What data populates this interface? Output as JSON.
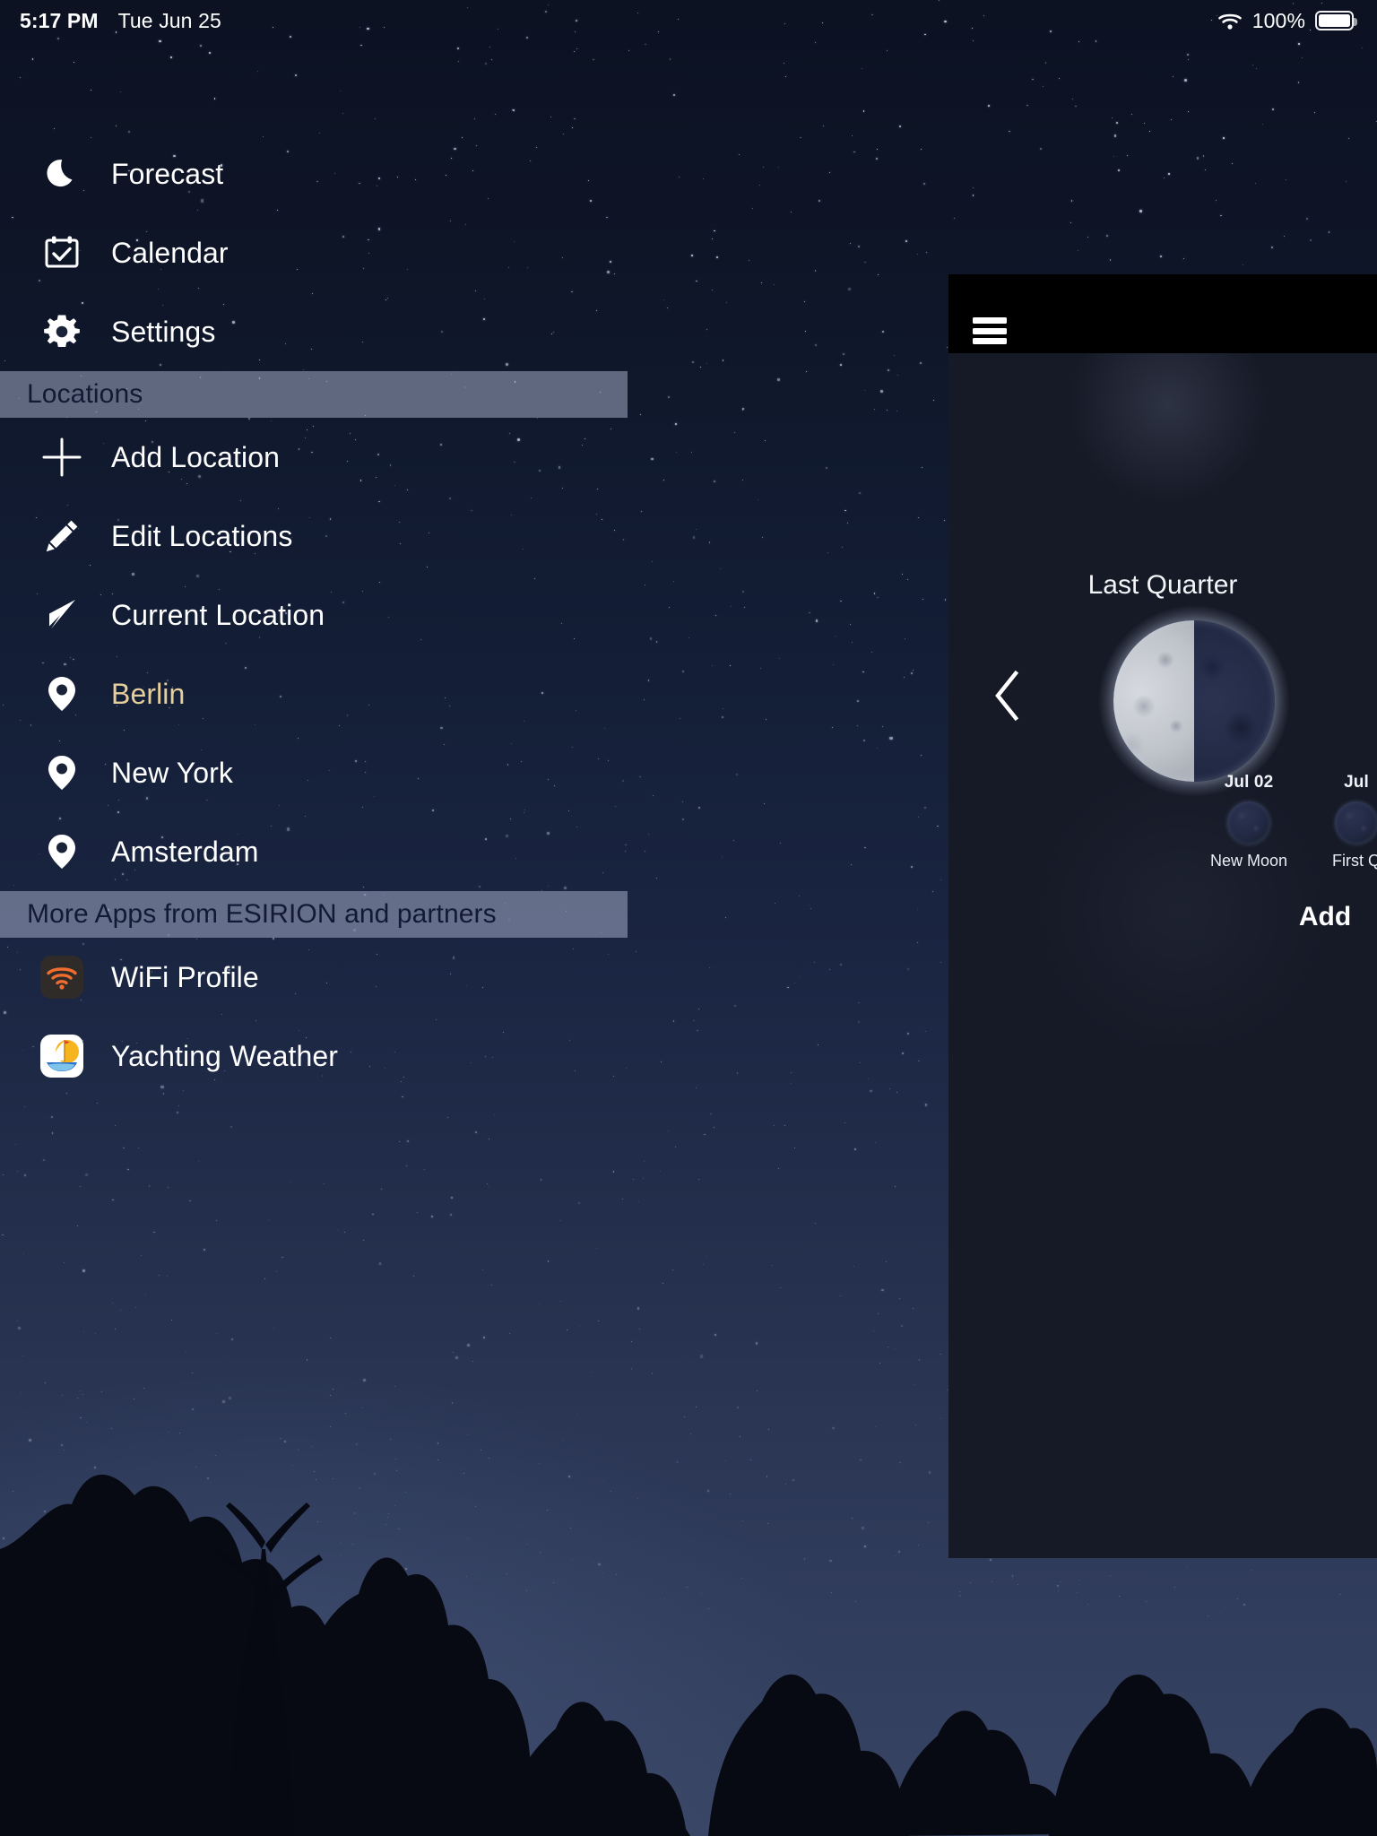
{
  "statusbar": {
    "time": "5:17 PM",
    "date": "Tue Jun 25",
    "wifi_icon": "wifi-icon",
    "battery_percent": "100%",
    "battery_icon": "battery-full-icon"
  },
  "sidebar": {
    "primary_items": [
      {
        "label": "Forecast",
        "icon": "crescent-moon-icon"
      },
      {
        "label": "Calendar",
        "icon": "calendar-check-icon"
      },
      {
        "label": "Settings",
        "icon": "gear-icon"
      }
    ],
    "locations_section": {
      "title": "Locations",
      "items": [
        {
          "label": "Add Location",
          "icon": "plus-icon",
          "accent": false
        },
        {
          "label": "Edit Locations",
          "icon": "pencil-icon",
          "accent": false
        },
        {
          "label": "Current Location",
          "icon": "navigate-icon",
          "accent": false
        },
        {
          "label": "Berlin",
          "icon": "map-pin-icon",
          "accent": true
        },
        {
          "label": "New York",
          "icon": "map-pin-icon",
          "accent": false
        },
        {
          "label": "Amsterdam",
          "icon": "map-pin-icon",
          "accent": false
        }
      ]
    },
    "more_apps_section": {
      "title": "More Apps from ESIRION and partners",
      "items": [
        {
          "label": "WiFi Profile",
          "icon": "wifi-profile-app-icon"
        },
        {
          "label": "Yachting Weather",
          "icon": "yachting-weather-app-icon"
        }
      ]
    }
  },
  "panel": {
    "menu_icon": "hamburger-menu-icon",
    "prev_icon": "chevron-left-icon",
    "current_phase": {
      "name": "Last Quarter",
      "illumination_side": "left"
    },
    "upcoming_phases": [
      {
        "date": "Jul 02",
        "name": "New Moon"
      },
      {
        "date": "Jul",
        "name": "First Q"
      }
    ],
    "cta_label": "Add"
  },
  "colors": {
    "accent_location": "#e7cf9c",
    "section_header_bg": "#abb2cd",
    "section_header_text": "#121a33",
    "panel_bg": "#161a27",
    "panel_header_bg": "#000000",
    "wifi_app_orange": "#ef6d2e",
    "yacht_app_yellow": "#f6b41e",
    "yacht_app_blue": "#2b72c8"
  }
}
